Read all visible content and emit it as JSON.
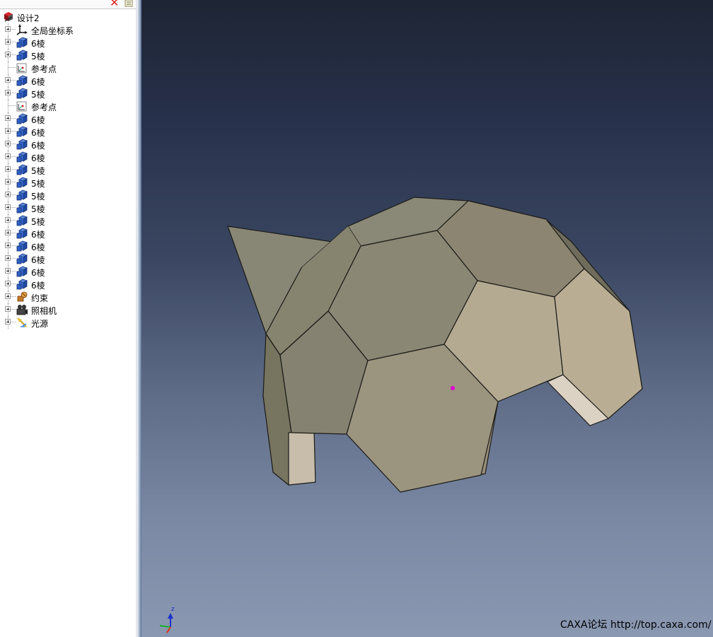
{
  "tree": {
    "root": {
      "label": "设计2",
      "icon": "design-root-icon"
    },
    "items": [
      {
        "label": "全局坐标系",
        "icon": "coordinate-axes-icon",
        "expandable": true
      },
      {
        "label": "6棱",
        "icon": "solid-part-icon",
        "expandable": true
      },
      {
        "label": "5棱",
        "icon": "solid-part-icon",
        "expandable": true
      },
      {
        "label": "参考点",
        "icon": "reference-point-icon",
        "expandable": false
      },
      {
        "label": "6棱",
        "icon": "solid-part-icon",
        "expandable": true
      },
      {
        "label": "5棱",
        "icon": "solid-part-icon",
        "expandable": true
      },
      {
        "label": "参考点",
        "icon": "reference-point-icon",
        "expandable": false
      },
      {
        "label": "6棱",
        "icon": "solid-part-icon",
        "expandable": true
      },
      {
        "label": "6棱",
        "icon": "solid-part-icon",
        "expandable": true
      },
      {
        "label": "6棱",
        "icon": "solid-part-icon",
        "expandable": true
      },
      {
        "label": "6棱",
        "icon": "solid-part-icon",
        "expandable": true
      },
      {
        "label": "5棱",
        "icon": "solid-part-icon",
        "expandable": true
      },
      {
        "label": "5棱",
        "icon": "solid-part-icon",
        "expandable": true
      },
      {
        "label": "5棱",
        "icon": "solid-part-icon",
        "expandable": true
      },
      {
        "label": "5棱",
        "icon": "solid-part-icon",
        "expandable": true
      },
      {
        "label": "5棱",
        "icon": "solid-part-icon",
        "expandable": true
      },
      {
        "label": "6棱",
        "icon": "solid-part-icon",
        "expandable": true
      },
      {
        "label": "6棱",
        "icon": "solid-part-icon",
        "expandable": true
      },
      {
        "label": "6棱",
        "icon": "solid-part-icon",
        "expandable": true
      },
      {
        "label": "6棱",
        "icon": "solid-part-icon",
        "expandable": true
      },
      {
        "label": "6棱",
        "icon": "solid-part-icon",
        "expandable": true
      },
      {
        "label": "约束",
        "icon": "constraint-icon",
        "expandable": true
      },
      {
        "label": "照相机",
        "icon": "camera-icon",
        "expandable": true
      },
      {
        "label": "光源",
        "icon": "light-source-icon",
        "expandable": true
      }
    ]
  },
  "viewport": {
    "axis_label": "z",
    "watermark": "CAXA论坛 http://top.caxa.com/"
  },
  "colors": {
    "background_top": "#1e2534",
    "background_bottom": "#8a98b2",
    "face_light": "#b8ad95",
    "face_dark": "#8a8774",
    "marker": "#e000d0"
  }
}
